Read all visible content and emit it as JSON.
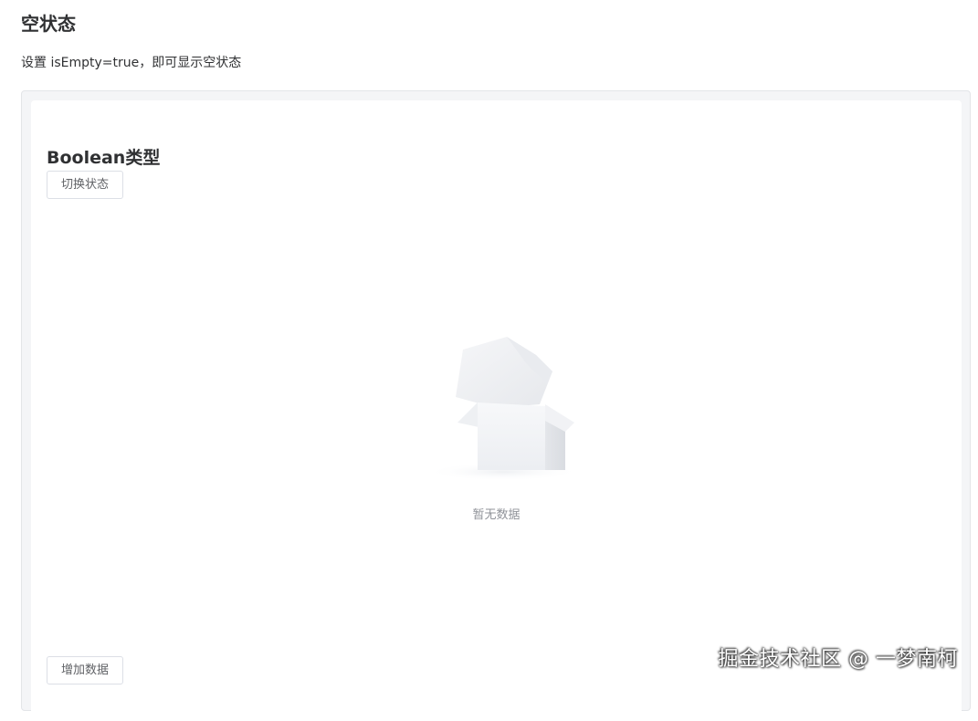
{
  "page": {
    "title": "空状态",
    "description": "设置 isEmpty=true，即可显示空状态"
  },
  "demo": {
    "heading": "Boolean类型",
    "toggle_button_label": "切换状态",
    "empty": {
      "icon": "empty-box-icon",
      "text": "暂无数据"
    },
    "add_button_label": "增加数据"
  },
  "watermark": "掘金技术社区 @ 一梦南柯",
  "colors": {
    "text_primary": "#303133",
    "text_secondary": "#909399",
    "border": "#dcdfe6",
    "outer_bg": "#f4f5f7"
  }
}
